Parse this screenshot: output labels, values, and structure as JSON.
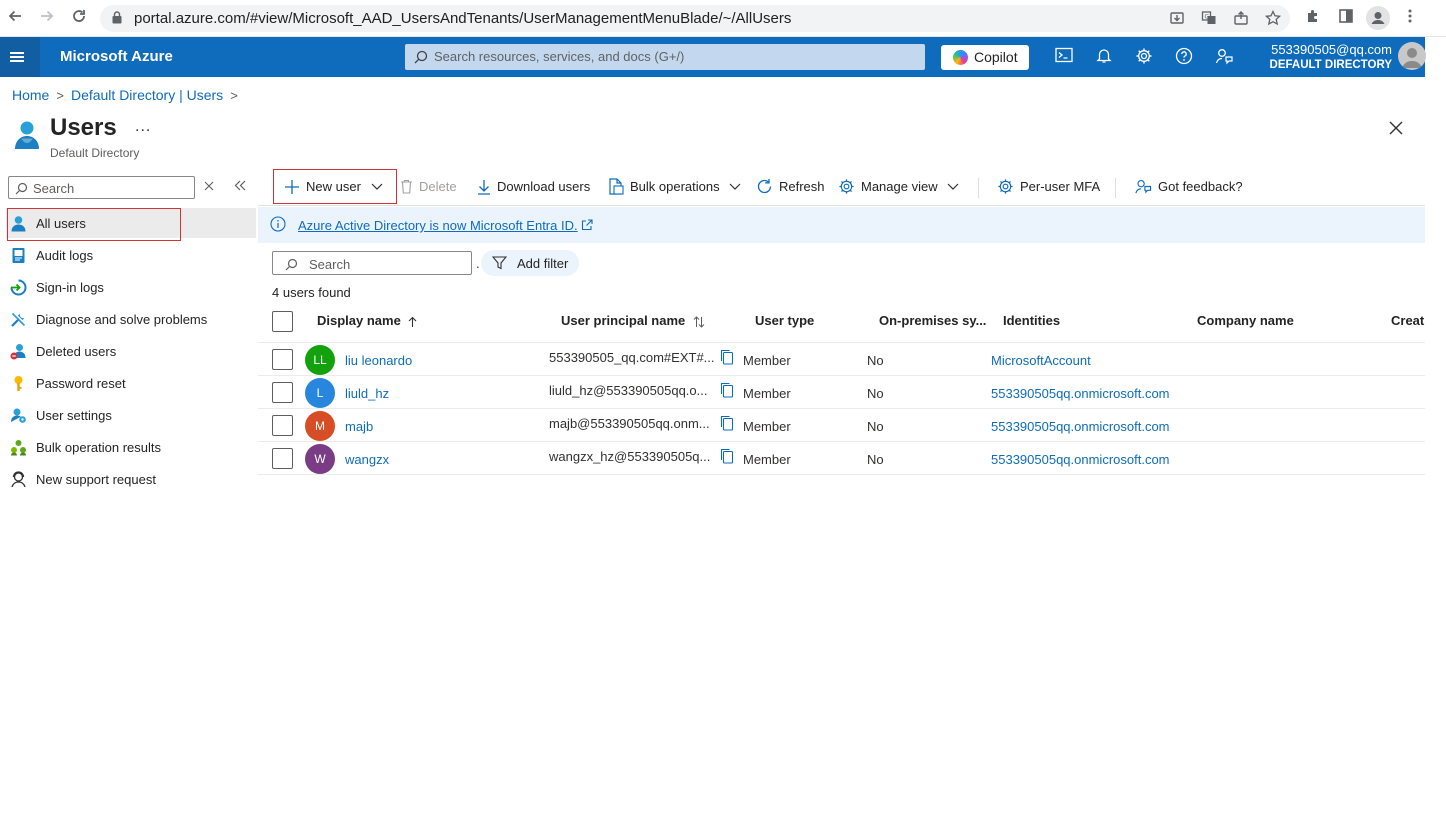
{
  "browser": {
    "url": "portal.azure.com/#view/Microsoft_AAD_UsersAndTenants/UserManagementMenuBlade/~/AllUsers"
  },
  "azure": {
    "brand": "Microsoft Azure",
    "search_placeholder": "Search resources, services, and docs (G+/)",
    "copilot_label": "Copilot",
    "account_email": "553390505@qq.com",
    "account_directory": "DEFAULT DIRECTORY",
    "brand_color": "#0f6cbd"
  },
  "breadcrumb": [
    "Home",
    "Default Directory | Users"
  ],
  "page": {
    "title": "Users",
    "more": "...",
    "subtitle": "Default Directory"
  },
  "nav": {
    "search_placeholder": "Search",
    "items": [
      {
        "label": "All users",
        "icon": "user-icon"
      },
      {
        "label": "Audit logs",
        "icon": "audit-log-icon"
      },
      {
        "label": "Sign-in logs",
        "icon": "sign-in-icon"
      },
      {
        "label": "Diagnose and solve problems",
        "icon": "wrench-icon"
      },
      {
        "label": "Deleted users",
        "icon": "deleted-user-icon"
      },
      {
        "label": "Password reset",
        "icon": "key-icon"
      },
      {
        "label": "User settings",
        "icon": "user-settings-icon"
      },
      {
        "label": "Bulk operation results",
        "icon": "bulk-results-icon"
      },
      {
        "label": "New support request",
        "icon": "support-icon"
      }
    ]
  },
  "toolbar": {
    "new_user": "New user",
    "delete": "Delete",
    "download": "Download users",
    "bulk": "Bulk operations",
    "refresh": "Refresh",
    "manage_view": "Manage view",
    "mfa": "Per-user MFA",
    "feedback": "Got feedback?"
  },
  "banner": {
    "text": "Azure Active Directory is now Microsoft Entra ID."
  },
  "filter": {
    "search_placeholder": "Search",
    "dot": ".",
    "add_filter": "Add filter",
    "count": "4 users found"
  },
  "table": {
    "headers": {
      "display_name": "Display name",
      "upn": "User principal name",
      "user_type": "User type",
      "onprem": "On-premises sy...",
      "identities": "Identities",
      "company": "Company name",
      "creation": "Creati"
    },
    "rows": [
      {
        "initials": "LL",
        "avatar_color": "#13a10e",
        "name": "liu leonardo",
        "upn": "553390505_qq.com#EXT#...",
        "type": "Member",
        "onprem": "No",
        "identity": "MicrosoftAccount"
      },
      {
        "initials": "L",
        "avatar_color": "#2886de",
        "name": "liuld_hz",
        "upn": "liuld_hz@553390505qq.o...",
        "type": "Member",
        "onprem": "No",
        "identity": "553390505qq.onmicrosoft.com"
      },
      {
        "initials": "M",
        "avatar_color": "#d74e26",
        "name": "majb",
        "upn": "majb@553390505qq.onm...",
        "type": "Member",
        "onprem": "No",
        "identity": "553390505qq.onmicrosoft.com"
      },
      {
        "initials": "W",
        "avatar_color": "#7a3d85",
        "name": "wangzx",
        "upn": "wangzx_hz@553390505q...",
        "type": "Member",
        "onprem": "No",
        "identity": "553390505qq.onmicrosoft.com"
      }
    ]
  }
}
